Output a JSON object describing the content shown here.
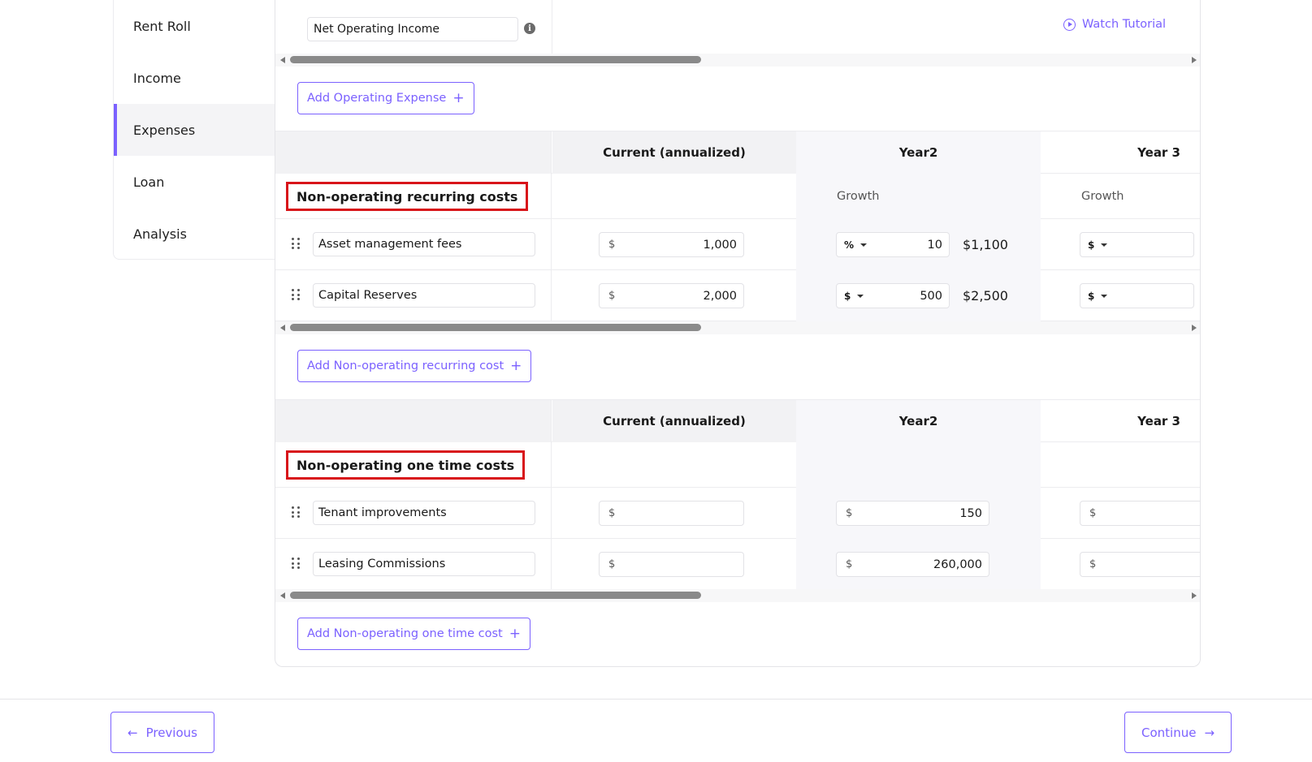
{
  "sidebar": {
    "items": [
      {
        "label": "Rent Roll"
      },
      {
        "label": "Income"
      },
      {
        "label": "Expenses"
      },
      {
        "label": "Loan"
      },
      {
        "label": "Analysis"
      }
    ]
  },
  "top": {
    "noi_label": "Net Operating Income",
    "info_glyph": "i",
    "watch_tutorial": "Watch Tutorial"
  },
  "operating": {
    "add_label": "Add Operating Expense"
  },
  "recurring": {
    "columns": {
      "current": "Current (annualized)",
      "year2": "Year2",
      "year3": "Year 3"
    },
    "title": "Non-operating recurring costs",
    "growth_label": "Growth",
    "rows": [
      {
        "name": "Asset management fees",
        "currency": "$",
        "current": "1,000",
        "y2_mode": "%",
        "y2_value": "10",
        "y2_result": "$1,100",
        "y3_mode": "$"
      },
      {
        "name": "Capital Reserves",
        "currency": "$",
        "current": "2,000",
        "y2_mode": "$",
        "y2_value": "500",
        "y2_result": "$2,500",
        "y3_mode": "$"
      }
    ],
    "add_label": "Add Non-operating recurring cost"
  },
  "onetime": {
    "columns": {
      "current": "Current (annualized)",
      "year2": "Year2",
      "year3": "Year 3"
    },
    "title": "Non-operating one time costs",
    "rows": [
      {
        "name": "Tenant improvements",
        "currency": "$",
        "current": "",
        "y2_value": "150",
        "y3_value": ""
      },
      {
        "name": "Leasing Commissions",
        "currency": "$",
        "current": "",
        "y2_value": "260,000",
        "y3_value": ""
      }
    ],
    "add_label": "Add Non-operating one time cost"
  },
  "footer": {
    "previous": "Previous",
    "continue": "Continue"
  },
  "colors": {
    "accent": "#7b61ff",
    "highlight_border": "#d8141a"
  }
}
